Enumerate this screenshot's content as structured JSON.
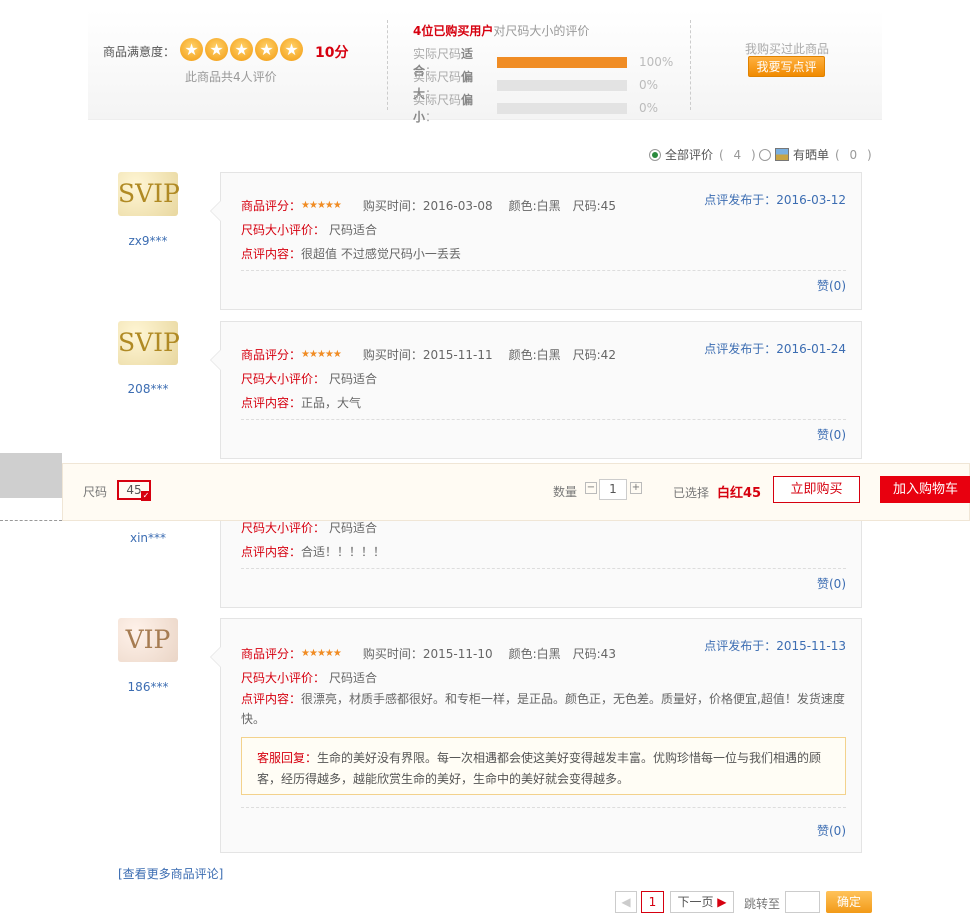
{
  "summary": {
    "satisfaction_label": "商品满意度：",
    "score": "10分",
    "count_text": "此商品共4人评价",
    "fit_title_strong": "4位已购买用户",
    "fit_title_rest": "对尺码大小的评价",
    "fit": [
      {
        "label_prefix": "实际尺码",
        "label_strong": "适合",
        "pct": "100%",
        "fraction": 1.0
      },
      {
        "label_prefix": "实际尺码",
        "label_strong": "偏大",
        "pct": "0%",
        "fraction": 0.0
      },
      {
        "label_prefix": "实际尺码",
        "label_strong": "偏小",
        "pct": "0%",
        "fraction": 0.0
      }
    ],
    "bought_text": "我购买过此商品",
    "write_button": "我要写点评",
    "rating_stars": 5
  },
  "filters": {
    "all": {
      "label": "全部评价",
      "count": "( 4 )"
    },
    "photo": {
      "label": "有晒单",
      "count": "( 0 )"
    }
  },
  "labels": {
    "rating": "商品评分：",
    "size_eval": "尺码大小评价：",
    "content": "点评内容：",
    "published": "点评发布于：",
    "reply": "客服回复："
  },
  "reviews": [
    {
      "level": "SVIP",
      "user": "zx9***",
      "purchase": "购买时间：2016-03-08",
      "color": "颜色:白黑",
      "size": "尺码:45",
      "size_eval": "尺码适合",
      "content": "很超值 不过感觉尺码小一丢丢",
      "date": "2016-03-12",
      "likes": "赞(0)"
    },
    {
      "level": "SVIP",
      "user": "208***",
      "purchase": "购买时间：2015-11-11",
      "color": "颜色:白黑",
      "size": "尺码:42",
      "size_eval": "尺码适合",
      "content": "正品，大气",
      "date": "2016-01-24",
      "likes": "赞(0)"
    },
    {
      "level": "",
      "user": "xin***",
      "purchase": "",
      "color": "",
      "size": "",
      "size_eval": "尺码适合",
      "content": "合适！！！！！",
      "date": "",
      "likes": "赞(0)"
    },
    {
      "level": "VIP",
      "user": "186***",
      "purchase": "购买时间：2015-11-10",
      "color": "颜色:白黑",
      "size": "尺码:43",
      "size_eval": "尺码适合",
      "content": "很漂亮，材质手感都很好。和专柜一样，是正品。颜色正，无色差。质量好，价格便宜,超值！发货速度快。",
      "date": "2015-11-13",
      "likes": "赞(0)",
      "reply": "生命的美好没有界限。每一次相遇都会使这美好变得越发丰富。优购珍惜每一位与我们相遇的顾客，经历得越多，越能欣赏生命的美好，生命中的美好就会变得越多。"
    }
  ],
  "buybar": {
    "size_label": "尺码",
    "size_value": "45",
    "qty_label": "数量",
    "qty_value": "1",
    "selected_label": "已选择",
    "selected_value": "白红45",
    "buy_now": "立即购买",
    "add_cart": "加入购物车"
  },
  "footer": {
    "more_link": "[查看更多商品评论]",
    "current_page": "1",
    "next": "下一页",
    "jump_label": "跳转至",
    "ok": "确定"
  }
}
